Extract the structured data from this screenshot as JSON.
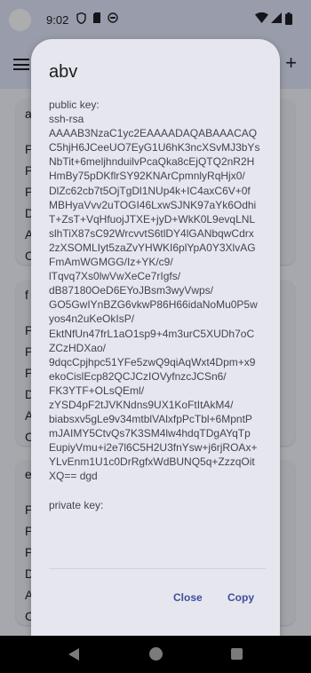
{
  "status": {
    "time": "9:02"
  },
  "background": {
    "cards": [
      {
        "title": "a",
        "lines": [
          "P",
          "P",
          "P",
          "D",
          "A",
          "C"
        ]
      },
      {
        "title": "f",
        "lines": [
          "P",
          "P",
          "P",
          "D",
          "A",
          "C"
        ]
      },
      {
        "title": "e",
        "lines": [
          "P",
          "P",
          "P",
          "D",
          "A",
          "C"
        ]
      }
    ]
  },
  "dialog": {
    "title": "abv",
    "public_key_label": "public key:",
    "public_key_lines": [
      "ssh-rsa",
      "AAAAB3NzaC1yc2EAAAADAQABAAACAQ",
      "C5hjH6JCeeUO7EyG1U6hK3ncXSvMJ3bYs",
      "NbTit+6meljhnduilvPcaQka8cEjQTQ2nR2H",
      "HmBy75pDKflrSY92KNArCpmnlyRqHjx0/",
      "DlZc62cb7t5OjTgDl1NUp4k+IC4axC6V+0f",
      "MBHyaVvv2uTOGI46LxwSJNK97aYk6Odhi",
      "T+ZsT+VqHfuojJTXE+jyD+WkK0L9evqLNL",
      "slhTiX87sC92WrcvvtS6tlDY4lGANbqwCdrx",
      "2zXSOMLIyt5zaZvYHWKI6plYpA0Y3XlvAG",
      "FmAmWGMGG/Iz+YK/c9/",
      "lTqvq7Xs0lwVwXeCe7rIgfs/",
      "dB87180OeD6EYoJBsm3wyVwps/",
      "GO5GwIYnBZG6vkwP86H66idaNoMu0P5w",
      "yos4n2uKeOkIsP/",
      "EktNfUn47frL1aO1sp9+4m3urC5XUDh7oC",
      "ZCzHDXao/",
      "9dqcCpjhpc51YFe5zwQ9qiAqWxt4Dpm+x9",
      "ekoCislEcp82QCJCzIOVyfnzcJCSn6/",
      "FK3YTF+OLsQEml/",
      "zYSD4pF2tJVKNdns9UX1KoFtItAkM4/",
      "biabsxv5gLe9v34mtblVAlxfpPcTbl+6MpntP",
      "mJAIMY5CtvQs7K3SM4lw4hdqTDgAYqTp",
      "EupiyVmu+i2e7l6C5H2U3fnYsw+j6rjROAx+",
      "YLvEnm1U1c0DrRgfxWdBUNQ5q+ZzzqOit",
      "XQ== dgd"
    ],
    "private_key_label": "private key:",
    "close_label": "Close",
    "copy_label": "Copy"
  }
}
